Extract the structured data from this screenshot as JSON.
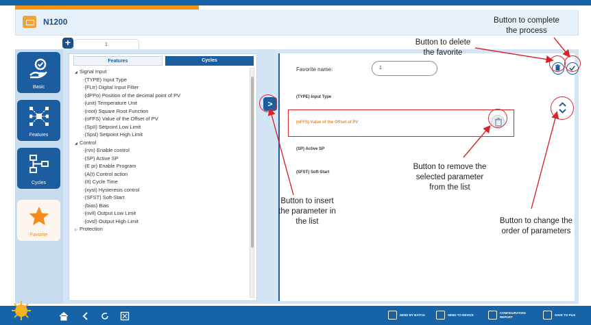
{
  "app": {
    "title": "N1200"
  },
  "tabs": {
    "add_label": "+",
    "current": "1"
  },
  "nav": [
    {
      "label": "Basic",
      "icon": "hand-check-icon"
    },
    {
      "label": "Features",
      "icon": "network-icon"
    },
    {
      "label": "Cycles",
      "icon": "flowchart-icon"
    },
    {
      "label": "Favorite",
      "icon": "star-icon"
    }
  ],
  "params_panel": {
    "tab_features": "Features",
    "tab_cycles": "Cycles",
    "groups": [
      {
        "label": "Signal Input",
        "items": [
          "(TYPE) Input Type",
          "(FLtr) Digital Input Filter",
          "(dPPo) Position of the decimal point of PV",
          "(unit) Temperature Unit",
          "(root) Square Root Function",
          "(oFFS) Value of the Offset of PV",
          "(SpII) Setpoint Low Limit",
          "(Spsl) Setpoint High Limit"
        ]
      },
      {
        "label": "Control",
        "items": [
          "(rvn) Enable control",
          "(SP) Active SP",
          "(E pr) Enable Program",
          "(A(t) Control action",
          "(It) Cycle Time",
          "(xyst) Hysteresis control",
          "(SFST) Soft-Start",
          "(bias) Bias",
          "(ovll) Output Low Limit",
          "(ovsl) Output High Limit"
        ]
      },
      {
        "label": "Protection",
        "items": []
      }
    ]
  },
  "insert_button": {
    "glyph": ">"
  },
  "favorite": {
    "name_label": "Favorite name:",
    "name_value": "1",
    "items": [
      "(TYPE) Input Type",
      "(oFFS) Value of the Offset of PV",
      "(SP) Active SP",
      "(SFST) Soft-Start"
    ],
    "selected_index": 1
  },
  "annotations": {
    "complete": "Button to complete\nthe process",
    "delete_fav": "Button to delete\nthe favorite",
    "insert": "Button to insert\nthe parameter in\nthe list",
    "remove": "Button to remove the\nselected parameter\nfrom the list",
    "order": "Button to change the\norder of parameters"
  },
  "bottom": {
    "actions": [
      {
        "label": "SEND BY BATCH",
        "icon": "send-batch-icon"
      },
      {
        "label": "SEND TO DEVICE",
        "icon": "send-device-icon"
      },
      {
        "label": "CONFIGURATION REPORT",
        "icon": "report-icon"
      },
      {
        "label": "SAVE TO FILE",
        "icon": "save-icon"
      }
    ]
  },
  "colors": {
    "brand_blue": "#1663a8",
    "nav_blue": "#1b5d9e",
    "accent_orange": "#f2931c",
    "annotation_red": "#d9242a"
  }
}
